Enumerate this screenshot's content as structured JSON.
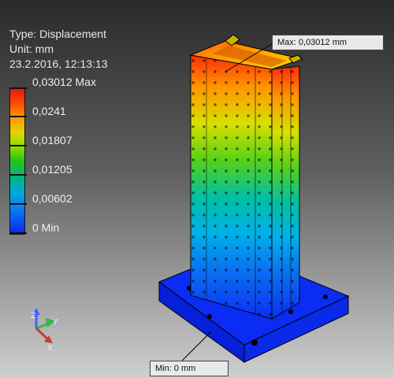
{
  "legend": {
    "type_line": "Type: Displacement",
    "unit_line": "Unit: mm",
    "date_line": "23.2.2016, 12:13:13",
    "ticks": [
      "0,03012 Max",
      "0,0241",
      "0,01807",
      "0,01205",
      "0,00602",
      "0 Min"
    ]
  },
  "callouts": {
    "max": "Max: 0,03012 mm",
    "min": "Min: 0 mm"
  },
  "triad": {
    "x": "X",
    "y": "Y",
    "z": "Z"
  },
  "colors": {
    "max": "#e11b0c",
    "min": "#0a27f3"
  },
  "icons": [
    "view-triad-icon"
  ]
}
